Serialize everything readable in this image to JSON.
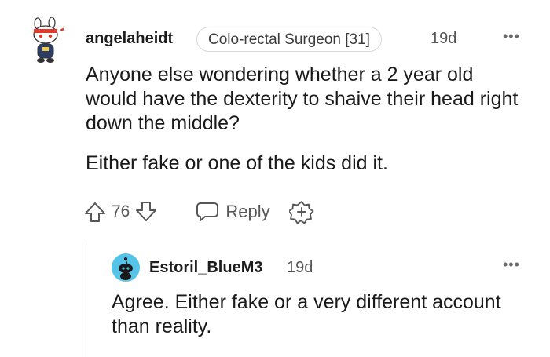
{
  "comment": {
    "author": "angelaheidt",
    "flair": "Colo-rectal Surgeon [31]",
    "age": "19d",
    "more_icon": "•••",
    "paragraphs": [
      "Anyone else wondering whether a 2 year old would have the dexterity to shaive their head right down the middle?",
      "Either fake or one of the kids did it."
    ],
    "score": "76",
    "reply_label": "Reply",
    "icons": {
      "upvote": "arrow-up-icon",
      "downvote": "arrow-down-icon",
      "reply": "speech-bubble-icon",
      "award": "add-award-icon",
      "avatar": "snoo-avatar"
    }
  },
  "reply": {
    "author": "Estoril_BlueM3",
    "age": "19d",
    "more_icon": "•••",
    "text": "Agree. Either fake or a very different account than reality.",
    "avatar_color": "#56c4e8"
  }
}
